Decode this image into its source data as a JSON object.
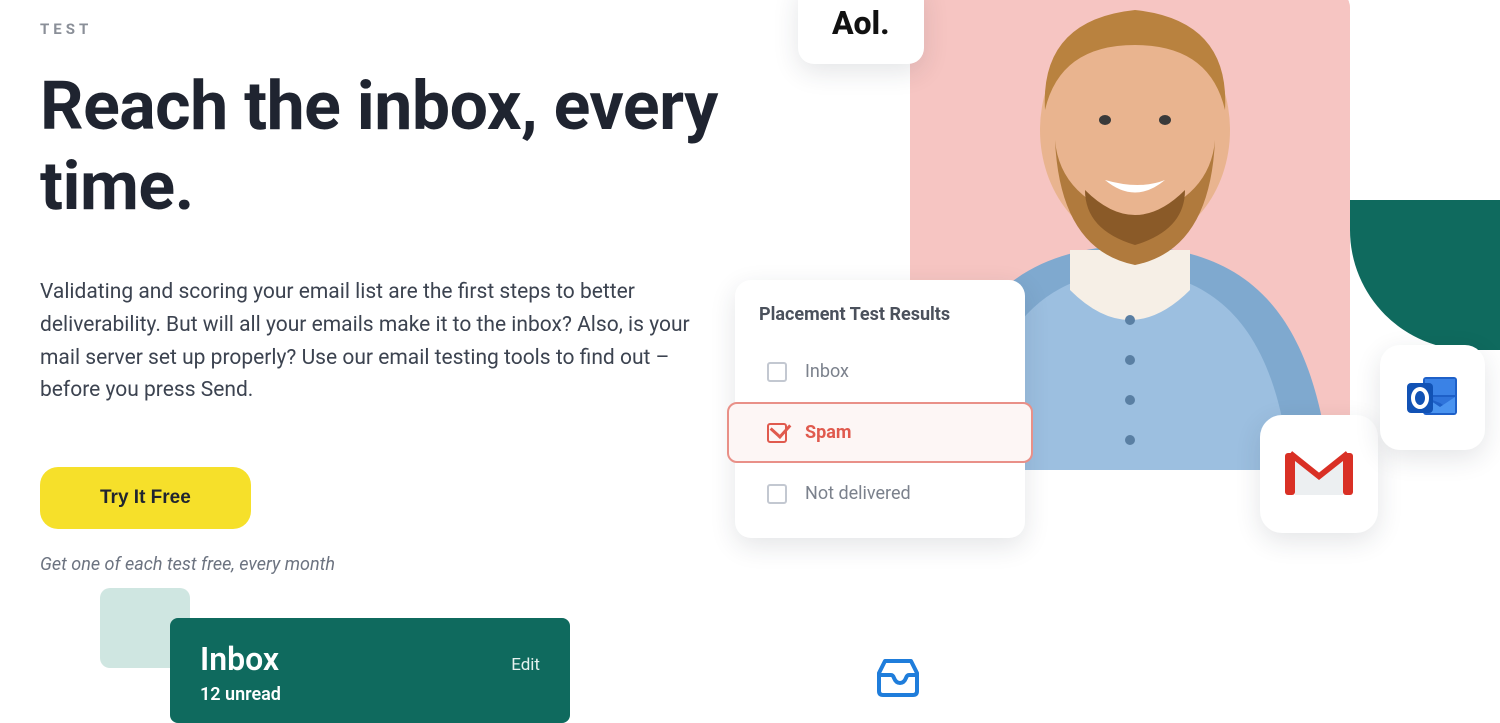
{
  "hero": {
    "eyebrow": "TEST",
    "headline": "Reach the inbox, every time.",
    "subcopy": "Validating and scoring your email list are the first steps to better deliverability. But will all your emails make it to the inbox? Also, is your mail server set up properly? Use our email testing tools to find out – before you press Send.",
    "cta_label": "Try It Free",
    "cta_sub": "Get one of each test free, every month"
  },
  "inbox_card": {
    "title": "Inbox",
    "edit_label": "Edit",
    "unread_text": "12 unread"
  },
  "placement": {
    "title": "Placement Test Results",
    "items": [
      {
        "label": "Inbox",
        "selected": false
      },
      {
        "label": "Spam",
        "selected": true
      },
      {
        "label": "Not delivered",
        "selected": false
      }
    ]
  },
  "brands": {
    "aol": "Aol."
  }
}
